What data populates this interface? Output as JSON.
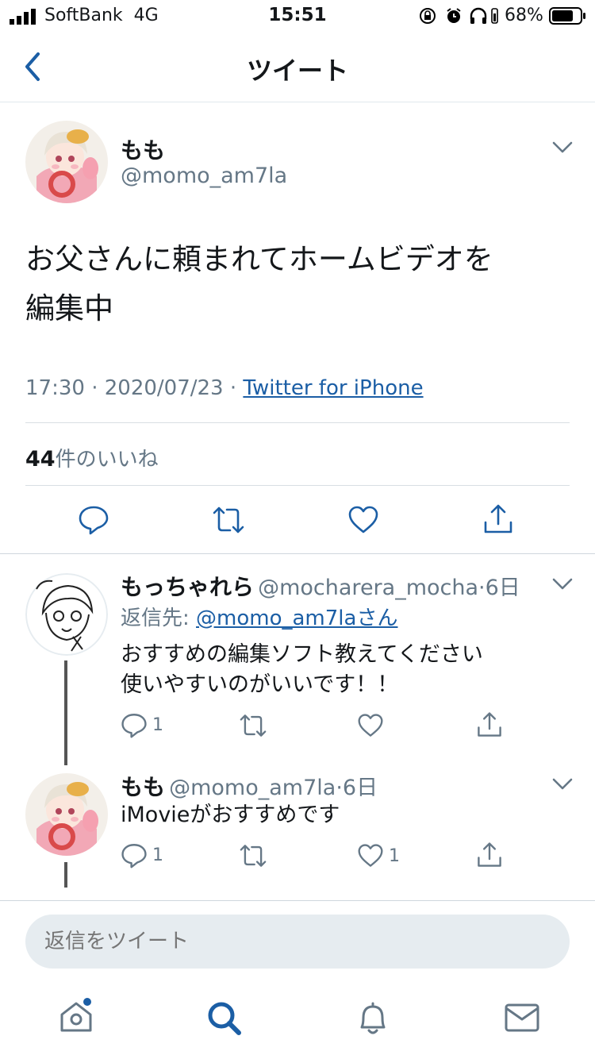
{
  "status_bar": {
    "carrier": "SoftBank",
    "network": "4G",
    "time": "15:51",
    "battery_percent": "68%"
  },
  "header": {
    "title": "ツイート"
  },
  "main_tweet": {
    "author_name": "もも",
    "author_handle": "@momo_am7la",
    "text_line1": "お父さんに頼まれてホームビデオを",
    "text_line2": "編集中",
    "time": "17:30",
    "date": "2020/07/23",
    "source": "Twitter for iPhone",
    "like_count": "44",
    "like_label": "件のいいね"
  },
  "replies": [
    {
      "author_name": "もっちゃれら",
      "author_handle": "@mocharera_mocha",
      "age": "6日",
      "reply_to_label": "返信先:",
      "reply_to_handle": "@momo_am7laさん",
      "text_line1": "おすすめの編集ソフト教えてください",
      "text_line2": "使いやすいのがいいです！！",
      "reply_count": "1",
      "retweet_count": "",
      "like_count": ""
    },
    {
      "author_name": "もも",
      "author_handle": "@momo_am7la",
      "age": "6日",
      "text_line1": "iMovieがおすすめです",
      "reply_count": "1",
      "retweet_count": "",
      "like_count": "1"
    }
  ],
  "reply_box": {
    "placeholder": "返信をツイート"
  },
  "icons": {
    "accent": "#1b5ea5",
    "muted": "#657786",
    "text": "#14171a",
    "notification_dot": "#1da1f2"
  }
}
